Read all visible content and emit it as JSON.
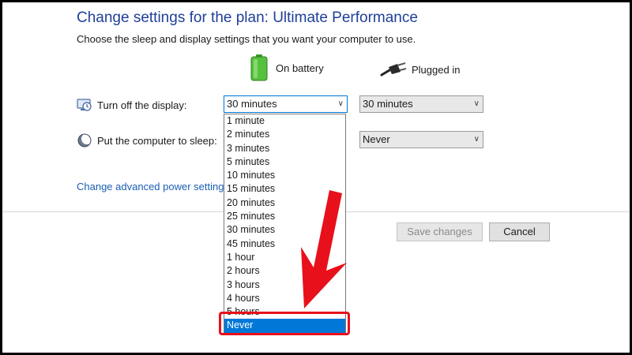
{
  "header": {
    "title": "Change settings for the plan: Ultimate Performance",
    "subtitle": "Choose the sleep and display settings that you want your computer to use."
  },
  "columns": {
    "battery_label": "On battery",
    "plugged_label": "Plugged in",
    "battery_icon": "battery-icon",
    "plugged_icon": "plug-icon"
  },
  "rows": {
    "display": {
      "label": "Turn off the display:",
      "icon": "display-icon",
      "battery_value": "30 minutes",
      "plugged_value": "30 minutes"
    },
    "sleep": {
      "label": "Put the computer to sleep:",
      "icon": "sleep-icon",
      "plugged_value": "Never"
    }
  },
  "advanced_link": "Change advanced power settings",
  "buttons": {
    "save": "Save changes",
    "cancel": "Cancel"
  },
  "dropdown": {
    "options": [
      "1 minute",
      "2 minutes",
      "3 minutes",
      "5 minutes",
      "10 minutes",
      "15 minutes",
      "20 minutes",
      "25 minutes",
      "30 minutes",
      "45 minutes",
      "1 hour",
      "2 hours",
      "3 hours",
      "4 hours",
      "5 hours",
      "Never"
    ],
    "highlighted": "Never"
  },
  "colors": {
    "title": "#1f3f9a",
    "link": "#1a5fb4",
    "selection": "#0078d7",
    "annotation": "#e8101a"
  }
}
